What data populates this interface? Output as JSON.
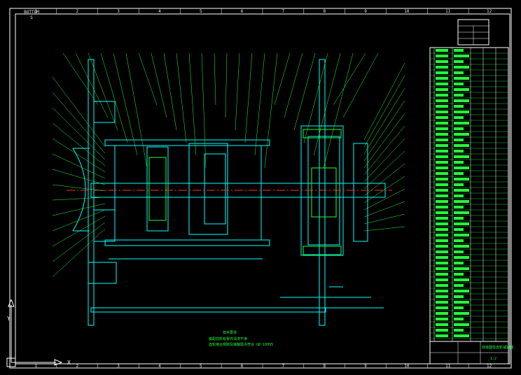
{
  "app": {
    "accent_color": "#22ff3a",
    "line_color": "#00ffff",
    "frame_color": "#ffffff",
    "background": "#000000"
  },
  "sheet": {
    "tag": "BOTTOM S",
    "columns_top": [
      "1",
      "2",
      "3",
      "4",
      "5",
      "6",
      "7",
      "8",
      "9",
      "10",
      "11",
      "12"
    ],
    "columns_bottom": [
      "1",
      "2",
      "3",
      "4",
      "5",
      "6",
      "7",
      "8",
      "9",
      "10",
      "11",
      "12"
    ]
  },
  "notes": {
    "title": "技术要求",
    "lines": [
      "装配前所有零件清洗干净",
      "齿轮啮合侧隙及接触斑点符合 GB 10095"
    ]
  },
  "title_block": {
    "name": "双级圆柱齿轮减速器",
    "scale": "1:2"
  },
  "icons": {
    "ucs": "ucs-axis-icon"
  }
}
